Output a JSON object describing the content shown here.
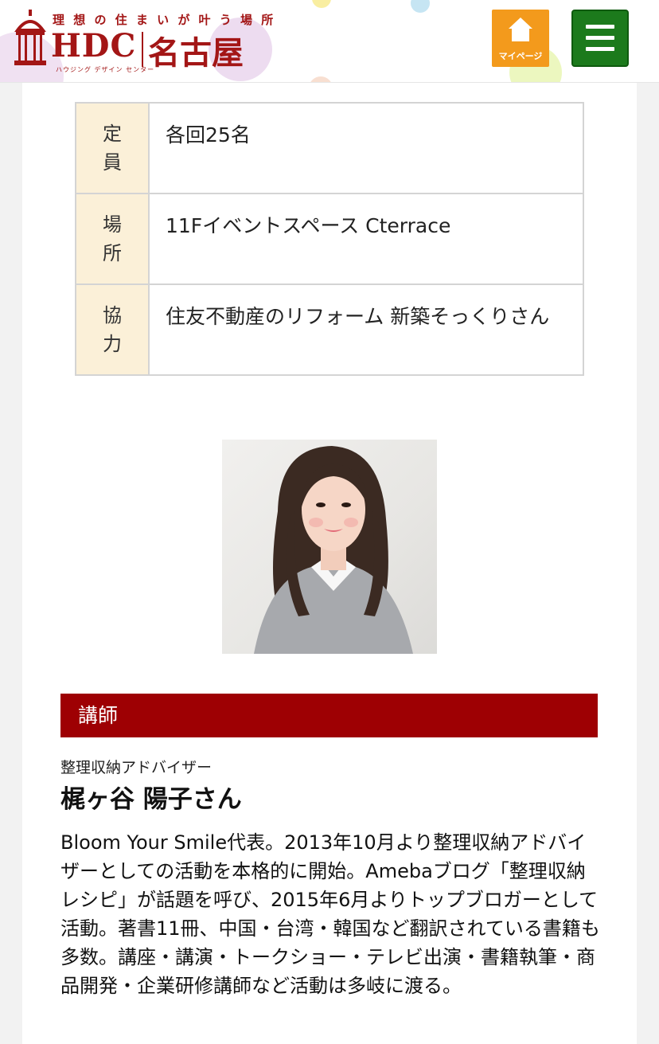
{
  "header": {
    "logo": {
      "tagline": "理 想 の 住 ま い が 叶 う 場 所",
      "brand": "HDC",
      "city": "名古屋",
      "subline": "ハウジング デザイン センター"
    },
    "mypage_label": "マイページ",
    "colors": {
      "brand_red": "#a31616",
      "mypage_orange": "#f39a1c",
      "menu_green": "#1c7a1c"
    }
  },
  "info_table": [
    {
      "label": "定員",
      "value": "各回25名"
    },
    {
      "label": "場所",
      "value": "11Fイベントスペース Cterrace"
    },
    {
      "label": "協力",
      "value": "住友不動産のリフォーム 新築そっくりさん"
    }
  ],
  "instructor": {
    "section_title": "講師",
    "role": "整理収納アドバイザー",
    "name": "梶ヶ谷 陽子さん",
    "bio": "Bloom Your Smile代表。2013年10月より整理収納アドバイザーとしての活動を本格的に開始。Amebaブログ「整理収納レシピ」が話題を呼び、2015年6月よりトップブロガーとして活動。著書11冊、中国・台湾・韓国など翻訳されている書籍も多数。講座・講演・トークショー・テレビ出演・書籍執筆・商品開発・企業研修講師など活動は多岐に渡る。",
    "colors": {
      "section_bar": "#9e0003"
    }
  }
}
